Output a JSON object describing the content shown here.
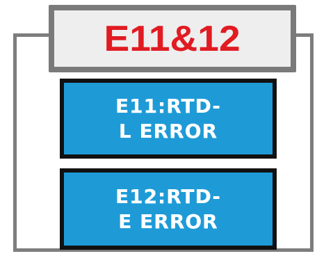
{
  "title": "E11&12",
  "errors": [
    {
      "code_line": "E11:RTD-",
      "message_line": "L ERROR"
    },
    {
      "code_line": "E12:RTD-",
      "message_line": "E ERROR"
    }
  ],
  "colors": {
    "title_text": "#e11b22",
    "title_badge_border": "#7a7a7a",
    "panel_border": "#7d7d7d",
    "card_background": "#1e9bd7",
    "card_border": "#111111",
    "card_text": "#ffffff"
  }
}
